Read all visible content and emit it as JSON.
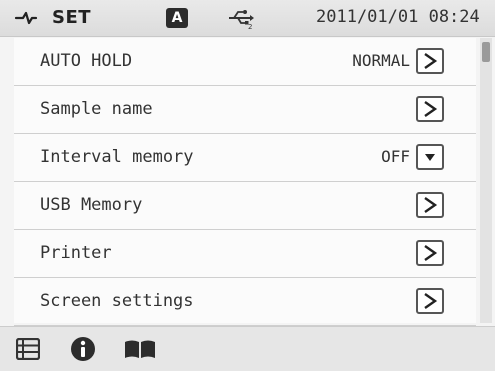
{
  "header": {
    "title": "SET",
    "mode_badge": "A",
    "datetime": "2011/01/01 08:24",
    "icons": [
      "wrench-icon",
      "usb-icon"
    ]
  },
  "menu": {
    "rows": [
      {
        "label": "AUTO HOLD",
        "value": "NORMAL",
        "control": "next-arrow"
      },
      {
        "label": "Sample name",
        "value": "",
        "control": "next-arrow"
      },
      {
        "label": "Interval memory",
        "value": "OFF",
        "control": "dropdown"
      },
      {
        "label": "USB Memory",
        "value": "",
        "control": "next-arrow"
      },
      {
        "label": "Printer",
        "value": "",
        "control": "next-arrow"
      },
      {
        "label": "Screen settings",
        "value": "",
        "control": "next-arrow"
      }
    ]
  },
  "footer": {
    "icons": [
      "list-icon",
      "info-icon",
      "book-icon"
    ]
  }
}
